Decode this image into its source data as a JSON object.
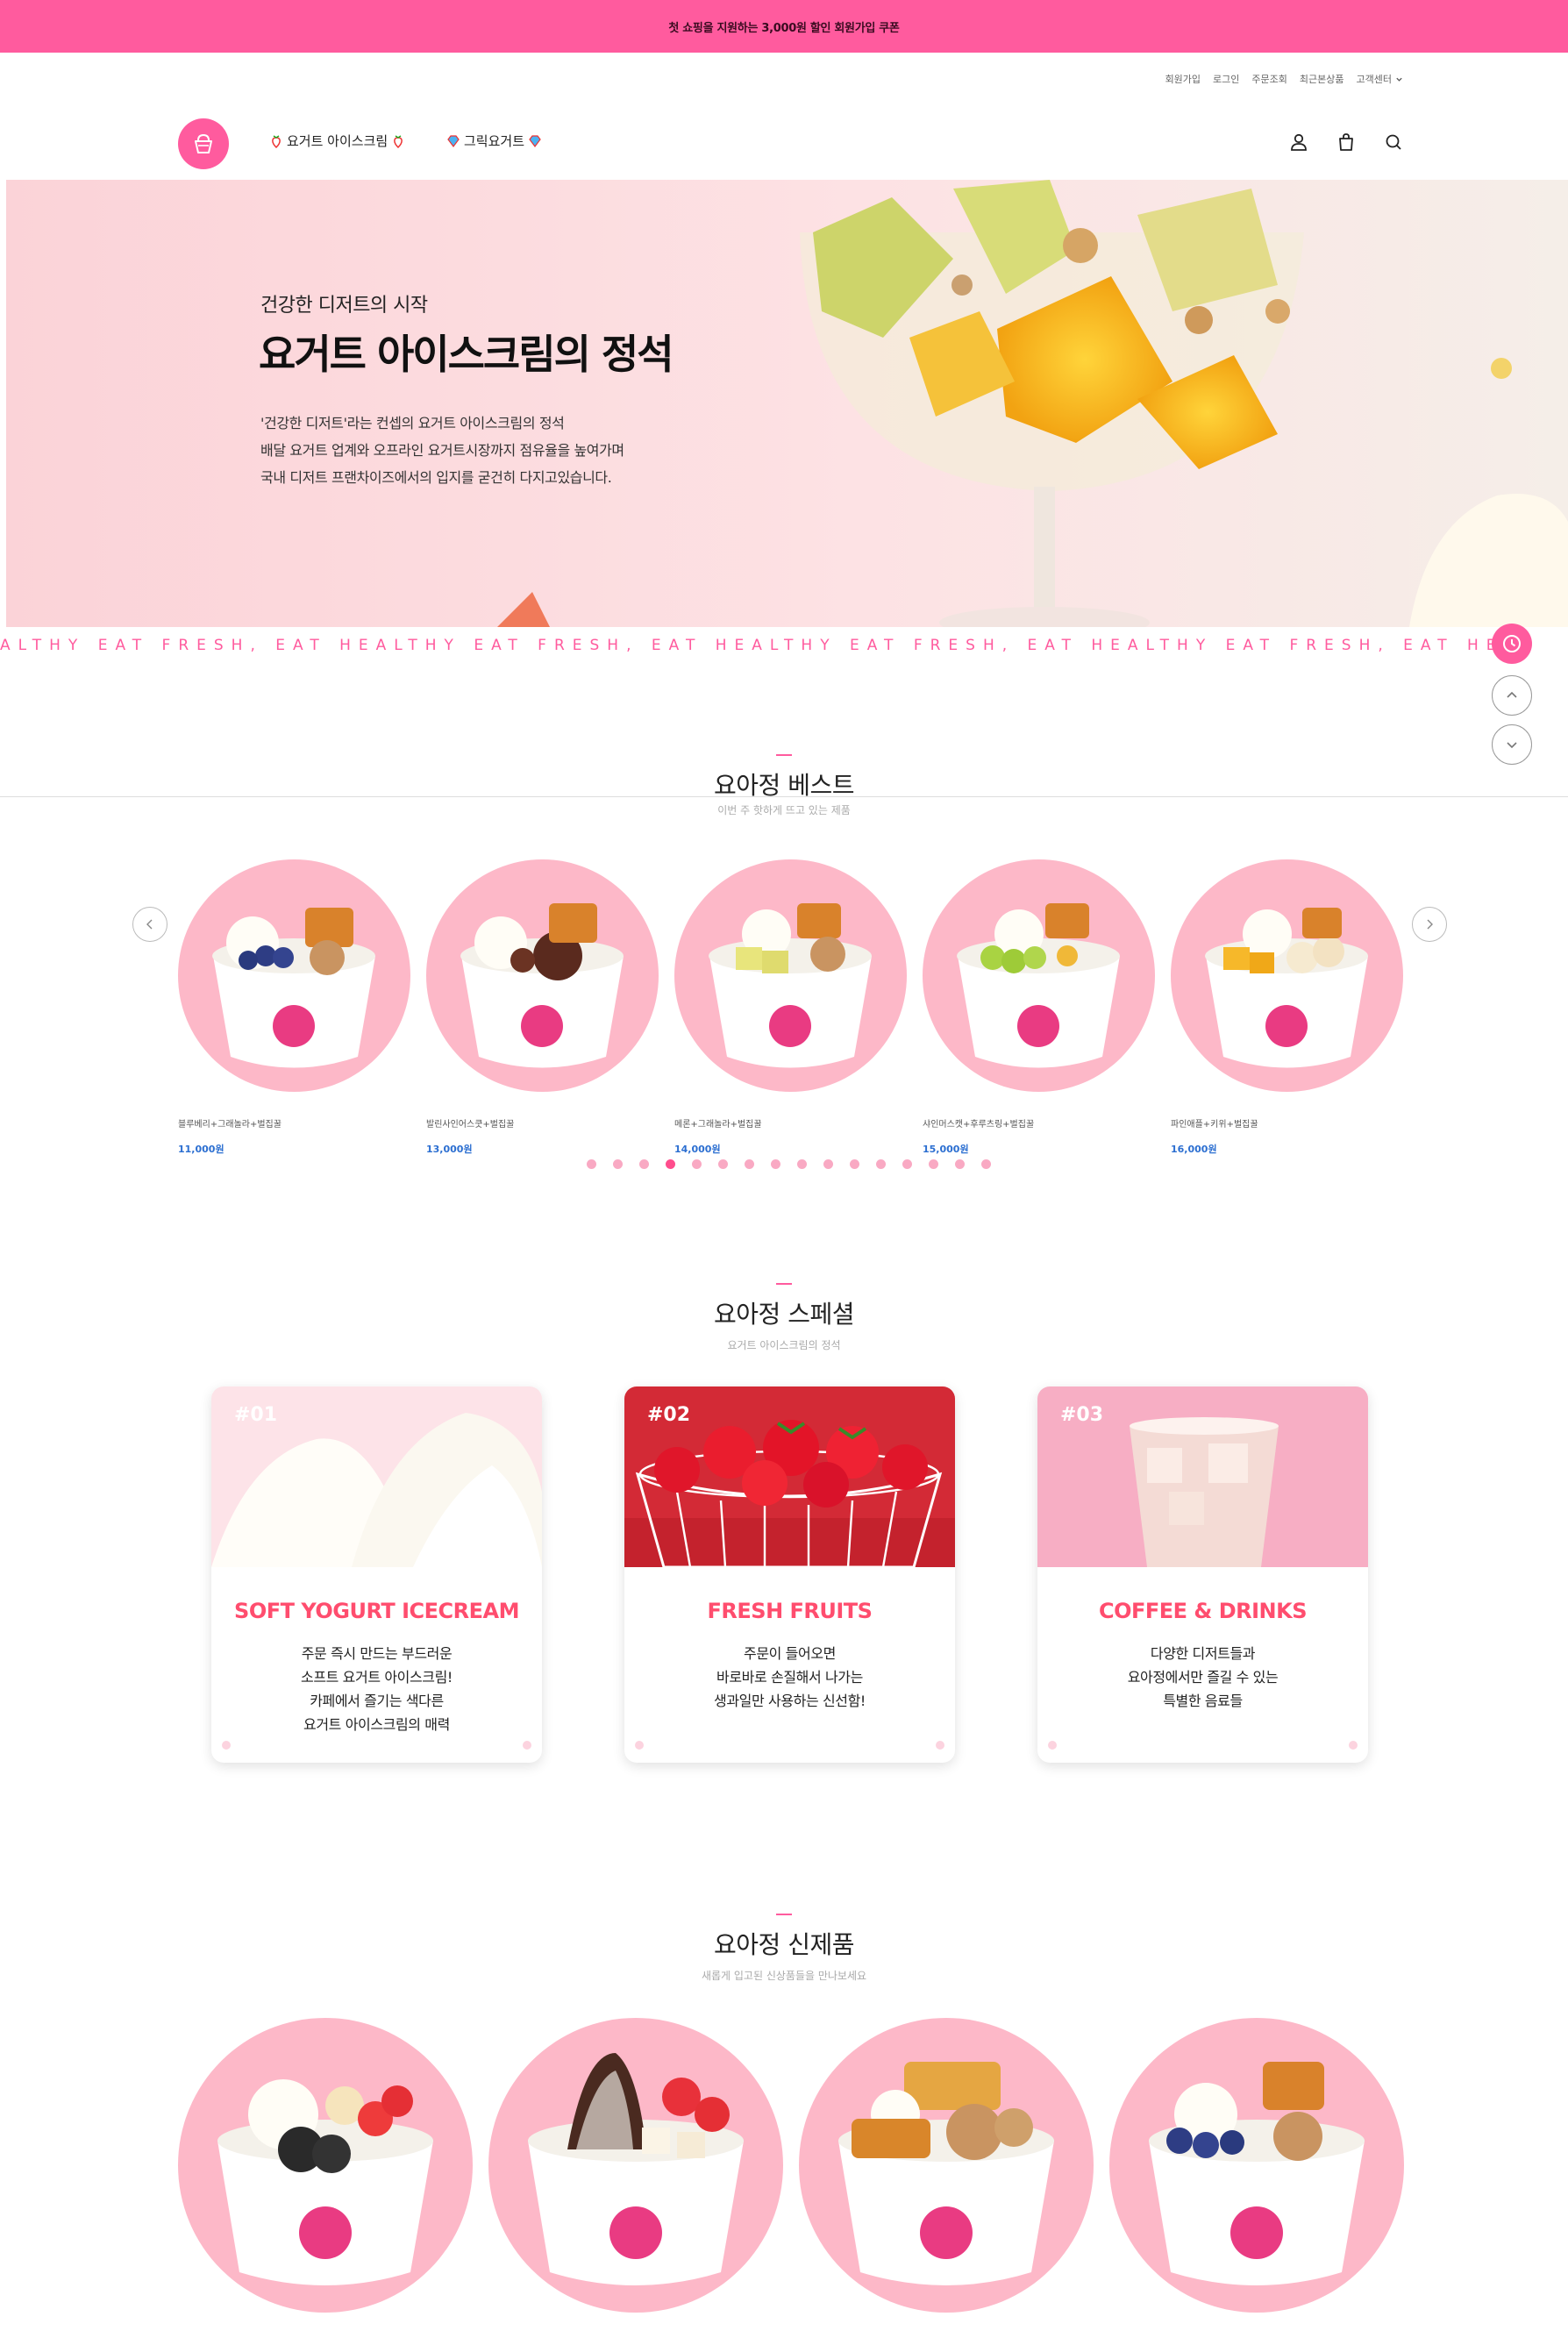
{
  "colors": {
    "accent": "#ff5b9e",
    "price": "#2c6fd1",
    "card_title": "#ff4d6e",
    "circle_bg": "#fdb8c8"
  },
  "top_banner": {
    "text": "첫 쇼핑을 지원하는 3,000원 할인 회원가입 쿠폰"
  },
  "util_links": {
    "signup": "회원가입",
    "login": "로그인",
    "order": "주문조회",
    "recent": "최근본상품",
    "cs": "고객센터"
  },
  "nav": {
    "item1": "요거트 아이스크림",
    "item2": "그릭요거트"
  },
  "icons": {
    "logo": "ice-cream-cup-icon",
    "user": "user-icon",
    "cart": "shopping-bag-icon",
    "search": "search-icon"
  },
  "hero": {
    "subtitle": "건강한 디저트의 시작",
    "title": "요거트 아이스크림의 정석",
    "desc1": "'건강한 디저트'라는 컨셉의 요거트 아이스크림의 정석",
    "desc2": "배달 요거트 업계와 오프라인 요거트시장까지 점유율을 높여가며",
    "desc3": "국내 디저트 프랜차이즈에서의 입지를 굳건히 다지고있습니다."
  },
  "marquee": {
    "text": "ALTHY EAT FRESH, EAT HEALTHY EAT FRESH, EAT HEALTHY EAT FRESH, EAT HEALTHY EAT FRESH, EAT HE"
  },
  "best": {
    "title": "요아정 베스트",
    "subtitle": "이번 주 핫하게 뜨고 있는 제품",
    "products": [
      {
        "name": "블루베리+그래놀라+벌집꿀",
        "price": "11,000원"
      },
      {
        "name": "발린사인어스쿳+벌집꿀",
        "price": "13,000원"
      },
      {
        "name": "메론+그래놀라+벌집꿀",
        "price": "14,000원"
      },
      {
        "name": "샤인머스캣+후루츠링+벌집꿀",
        "price": "15,000원"
      },
      {
        "name": "파인애플+키위+벌집꿀",
        "price": "16,000원"
      }
    ],
    "dots_total": 16,
    "dots_active": 4
  },
  "special": {
    "title": "요아정 스페셜",
    "subtitle": "요거트 아이스크림의 정석",
    "cards": [
      {
        "num": "#01",
        "title": "SOFT YOGURT ICECREAM",
        "lines": [
          "주문 즉시 만드는 부드러운",
          "소프트 요거트 아이스크림!",
          "카페에서 즐기는 색다른",
          "요거트 아이스크림의 매력"
        ]
      },
      {
        "num": "#02",
        "title": "FRESH FRUITS",
        "lines": [
          "주문이 들어오면",
          "바로바로 손질해서 나가는",
          "생과일만 사용하는 신선함!"
        ]
      },
      {
        "num": "#03",
        "title": "COFFEE & DRINKS",
        "lines": [
          "다양한 디저트들과",
          "요아정에서만 즐길 수 있는",
          "특별한 음료들"
        ]
      }
    ]
  },
  "new_products": {
    "title": "요아정 신제품",
    "subtitle": "새롭게 입고된 신상품들을 만나보세요"
  }
}
